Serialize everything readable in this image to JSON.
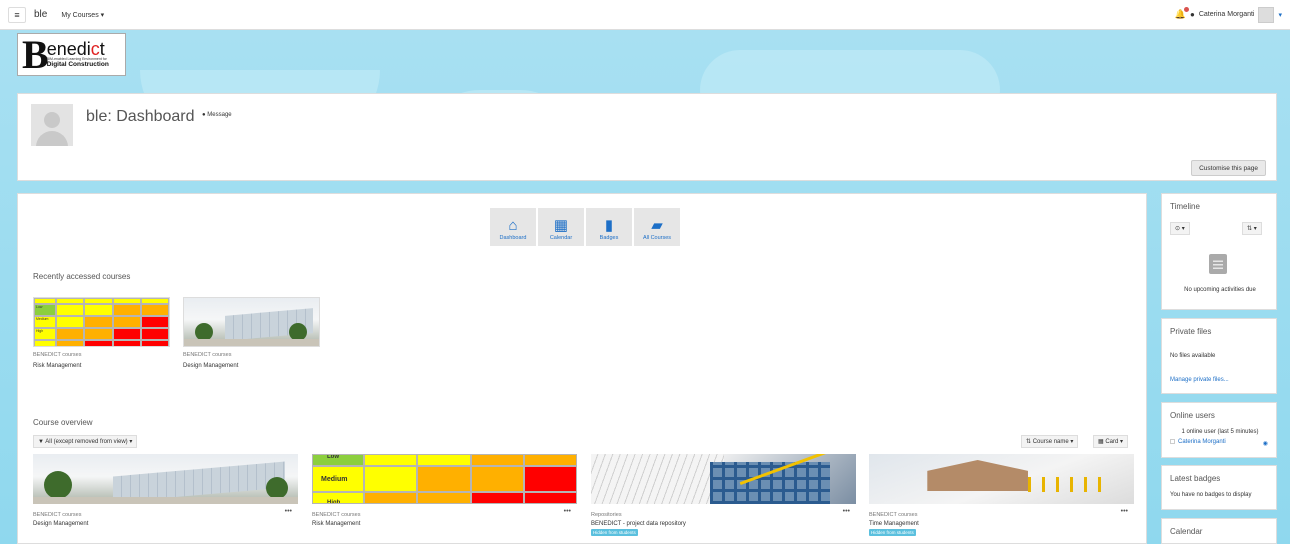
{
  "navbar": {
    "menu_icon": "hamburger-icon",
    "site_name": "ble",
    "my_courses": "My Courses",
    "user_name": "Caterina Morganti"
  },
  "logo": {
    "b": "B",
    "word_pre": "enedi",
    "word_mid": "c",
    "word_post": "t",
    "tagline": "BIM-enabled Learning Environment for",
    "tagline2": "Digital Construction"
  },
  "header": {
    "title": "ble: Dashboard",
    "message": "Message",
    "customise": "Customise this page"
  },
  "quicklinks": [
    {
      "icon": "home-icon",
      "glyph": "⌂",
      "label": "Dashboard"
    },
    {
      "icon": "calendar-icon",
      "glyph": "▦",
      "label": "Calendar"
    },
    {
      "icon": "bookmark-icon",
      "glyph": "▮",
      "label": "Badges"
    },
    {
      "icon": "book-icon",
      "glyph": "▰",
      "label": "All Courses"
    }
  ],
  "recent": {
    "title": "Recently accessed courses",
    "cards": [
      {
        "category": "BENEDICT courses",
        "name": "Risk Management"
      },
      {
        "category": "BENEDICT courses",
        "name": "Design Management"
      }
    ]
  },
  "overview": {
    "title": "Course overview",
    "filter": "All (except removed from view)",
    "sort": "Course name",
    "view": "Card",
    "cards": [
      {
        "category": "BENEDICT courses",
        "name": "Design Management",
        "badge": ""
      },
      {
        "category": "BENEDICT courses",
        "name": "Risk Management",
        "badge": ""
      },
      {
        "category": "Repositories",
        "name": "BENEDICT - project data repository",
        "badge": "Hidden from students"
      },
      {
        "category": "BENEDICT courses",
        "name": "Time Management",
        "badge": "Hidden from students"
      }
    ]
  },
  "risk_matrix_labels": {
    "low": "Low",
    "medium": "Medium",
    "high": "High"
  },
  "sidebar": {
    "timeline": {
      "title": "Timeline",
      "empty": "No upcoming activities due"
    },
    "private_files": {
      "title": "Private files",
      "empty": "No files available",
      "manage": "Manage private files..."
    },
    "online_users": {
      "title": "Online users",
      "summary": "1 online user (last 5 minutes)",
      "user": "Caterina Morganti"
    },
    "latest_badges": {
      "title": "Latest badges",
      "empty": "You have no badges to display"
    },
    "calendar": {
      "title": "Calendar"
    }
  },
  "colors": {
    "accent": "#1d6fc7",
    "badge": "#5bc0de",
    "background": "#8fd8ee"
  }
}
